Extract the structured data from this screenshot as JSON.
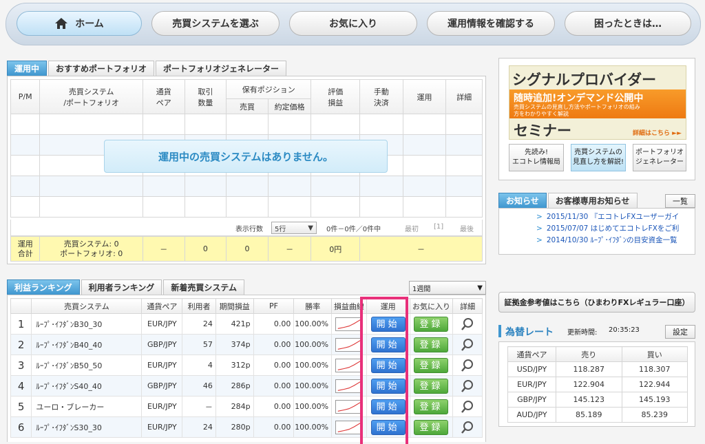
{
  "nav": {
    "items": [
      "ホーム",
      "売買システムを選ぶ",
      "お気に入り",
      "運用情報を確認する",
      "困ったときは…"
    ]
  },
  "ops_tabs": [
    "運用中",
    "おすすめポートフォリオ",
    "ポートフォリオジェネレーター"
  ],
  "ops_table": {
    "headers": {
      "pm": "P/M",
      "system": "売買システム\n/ポートフォリオ",
      "pair": "通貨\nペア",
      "qty": "取引\n数量",
      "position": "保有ポジション",
      "buysell": "売買",
      "price": "約定価格",
      "eval": "評価\n損益",
      "manual": "手動\n決済",
      "run": "運用",
      "detail": "詳細"
    },
    "empty_message": "運用中の売買システムはありません。",
    "pager": {
      "rows_label": "表示行数",
      "rows_value": "5行",
      "count": "0件－0件／0件中",
      "first": "最初",
      "page": "[1]",
      "last": "最後"
    },
    "summary": {
      "label": "運用\n合計",
      "systems": "売買システム: 0\nポートフォリオ: 0",
      "c1": "－",
      "c2": "0",
      "c3": "0",
      "c4": "－",
      "c5": "0円",
      "c6": "－"
    }
  },
  "rank_tabs": [
    "利益ランキング",
    "利用者ランキング",
    "新着売買システム"
  ],
  "rank_period": "1週間",
  "rank_table": {
    "headers": [
      "",
      "売買システム",
      "通貨ペア",
      "利用者",
      "期間損益",
      "PF",
      "勝率",
      "損益曲線",
      "運用",
      "お気に入り",
      "詳細"
    ],
    "start_label": "開始",
    "register_label": "登録",
    "rows": [
      {
        "rank": "1",
        "name": "ﾙｰﾌﾟ･ｲﾌﾀﾞﾝB30_30",
        "pair": "EUR/JPY",
        "users": "24",
        "pl": "421p",
        "pf": "0.00",
        "win": "100.00%"
      },
      {
        "rank": "2",
        "name": "ﾙｰﾌﾟ･ｲﾌﾀﾞﾝB40_40",
        "pair": "GBP/JPY",
        "users": "57",
        "pl": "374p",
        "pf": "0.00",
        "win": "100.00%"
      },
      {
        "rank": "3",
        "name": "ﾙｰﾌﾟ･ｲﾌﾀﾞﾝB50_50",
        "pair": "EUR/JPY",
        "users": "4",
        "pl": "312p",
        "pf": "0.00",
        "win": "100.00%"
      },
      {
        "rank": "4",
        "name": "ﾙｰﾌﾟ･ｲﾌﾀﾞﾝS40_40",
        "pair": "GBP/JPY",
        "users": "46",
        "pl": "286p",
        "pf": "0.00",
        "win": "100.00%"
      },
      {
        "rank": "5",
        "name": "ユーロ・ブレーカー",
        "pair": "EUR/JPY",
        "users": "－",
        "pl": "284p",
        "pf": "0.00",
        "win": "100.00%"
      },
      {
        "rank": "6",
        "name": "ﾙｰﾌﾟ･ｲﾌﾀﾞﾝS30_30",
        "pair": "EUR/JPY",
        "users": "24",
        "pl": "280p",
        "pf": "0.00",
        "win": "100.00%"
      }
    ]
  },
  "banner": {
    "title": "シグナルプロバイダー",
    "line1": "随時追加!オンデマンド公開中",
    "line2": "売買システムの見直し方法やポートフォリオの組み",
    "line3": "方をわかりやすく解説",
    "seminar": "セミナー",
    "more": "詳細はこちら ►►"
  },
  "side_buttons": [
    "先読み!\nエコトレ情報局",
    "売買システムの\n見直し方を解説!",
    "ポートフォリオ\nジェネレーター"
  ],
  "news": {
    "tabs": [
      "お知らせ",
      "お客様専用お知らせ"
    ],
    "list_button": "一覧",
    "items": [
      "2015/11/30 『エコトレFXユーザーガイ",
      "2015/07/07 はじめてエコトレFXをご利",
      "2014/10/30 ﾙｰﾌﾟ･ｲﾌﾀﾞﾝの目安資金一覧"
    ]
  },
  "margin_link": "証拠金参考値はこちら（ひまわりFXレギュラー口座）",
  "rates": {
    "title": "為替レート",
    "updated_label": "更新時間:",
    "updated_time": "20:35:23",
    "settings": "設定",
    "headers": [
      "通貨ペア",
      "売り",
      "買い"
    ],
    "rows": [
      [
        "USD/JPY",
        "118.287",
        "118.307"
      ],
      [
        "EUR/JPY",
        "122.904",
        "122.944"
      ],
      [
        "GBP/JPY",
        "145.123",
        "145.193"
      ],
      [
        "AUD/JPY",
        "85.189",
        "85.239"
      ]
    ]
  },
  "colors": {
    "accent_blue": "#3f96cf",
    "highlight_pink": "#e8307a",
    "summary_yellow": "#fff9b0",
    "start_blue": "#2f72d0",
    "register_green": "#4ea83a"
  }
}
